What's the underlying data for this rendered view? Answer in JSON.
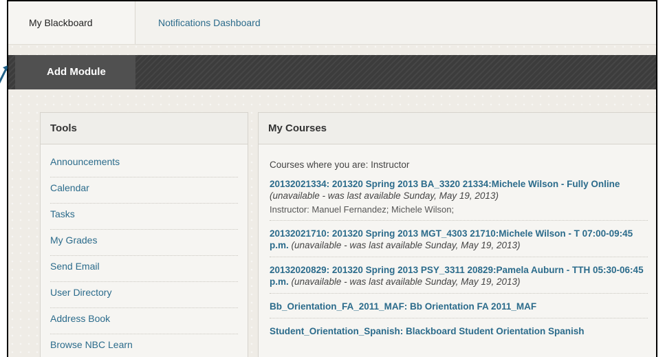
{
  "tabs": {
    "my_blackboard": "My Blackboard",
    "notifications": "Notifications Dashboard"
  },
  "toolbar": {
    "add_module": "Add Module"
  },
  "tools": {
    "title": "Tools",
    "items": [
      "Announcements",
      "Calendar",
      "Tasks",
      "My Grades",
      "Send Email",
      "User Directory",
      "Address Book",
      "Browse NBC Learn"
    ]
  },
  "courses": {
    "title": "My Courses",
    "role_line": "Courses where you are: Instructor",
    "list": [
      {
        "title": "20132021334: 201320 Spring 2013 BA_3320 21334:Michele Wilson - Fully Online",
        "note": "(unavailable - was last available Sunday, May 19, 2013)",
        "instructor": "Instructor: Manuel Fernandez;  Michele Wilson;"
      },
      {
        "title": "20132021710: 201320 Spring 2013 MGT_4303 21710:Michele Wilson - T 07:00-09:45 p.m.",
        "note": "(unavailable - was last available Sunday, May 19, 2013)"
      },
      {
        "title": "20132020829: 201320 Spring 2013 PSY_3311 20829:Pamela Auburn - TTH 05:30-06:45 p.m.",
        "note": "(unavailable - was last available Sunday, May 19, 2013)"
      },
      {
        "title": "Bb_Orientation_FA_2011_MAF: Bb Orientation FA 2011_MAF"
      },
      {
        "title": "Student_Orientation_Spanish: Blackboard Student Orientation Spanish"
      }
    ]
  },
  "colors": {
    "link": "#2b6b8b",
    "dark_band": "#3c3c3c",
    "arrow": "#1f5f86"
  },
  "icons": {
    "pointer": "arrow-icon"
  }
}
